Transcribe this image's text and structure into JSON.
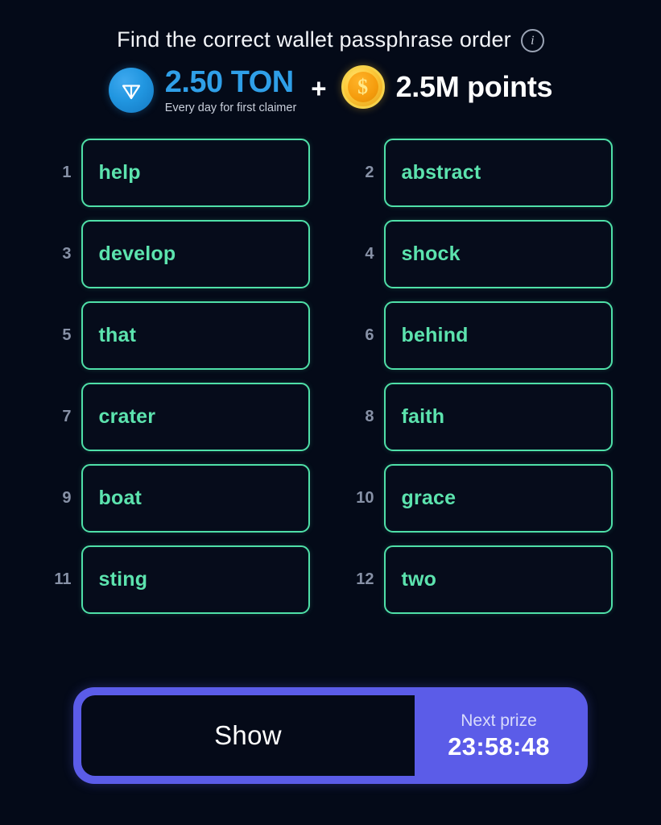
{
  "header": {
    "title": "Find the correct wallet passphrase order",
    "info_icon": "info-icon",
    "info_glyph": "i"
  },
  "reward": {
    "ton_icon": "ton-coin-icon",
    "ton_amount": "2.50 TON",
    "ton_subtitle": "Every day for first claimer",
    "separator": "+",
    "coin_icon": "dollar-coin-icon",
    "coin_glyph": "$",
    "points_amount": "2.5M points",
    "colors": {
      "ton_blue": "#2f9fe8",
      "coin_gold": "#f5c02a",
      "points_white": "#ffffff"
    }
  },
  "passphrase": {
    "tiles": [
      {
        "index": "1",
        "word": "help"
      },
      {
        "index": "2",
        "word": "abstract"
      },
      {
        "index": "3",
        "word": "develop"
      },
      {
        "index": "4",
        "word": "shock"
      },
      {
        "index": "5",
        "word": "that"
      },
      {
        "index": "6",
        "word": "behind"
      },
      {
        "index": "7",
        "word": "crater"
      },
      {
        "index": "8",
        "word": "faith"
      },
      {
        "index": "9",
        "word": "boat"
      },
      {
        "index": "10",
        "word": "grace"
      },
      {
        "index": "11",
        "word": "sting"
      },
      {
        "index": "12",
        "word": "two"
      }
    ],
    "tile_border_color": "#4fe0a8",
    "tile_text_color": "#5ce3ae"
  },
  "footer": {
    "show_label": "Show",
    "next_prize_label": "Next prize",
    "timer": "23:58:48",
    "accent_color": "#5b5ce8"
  }
}
